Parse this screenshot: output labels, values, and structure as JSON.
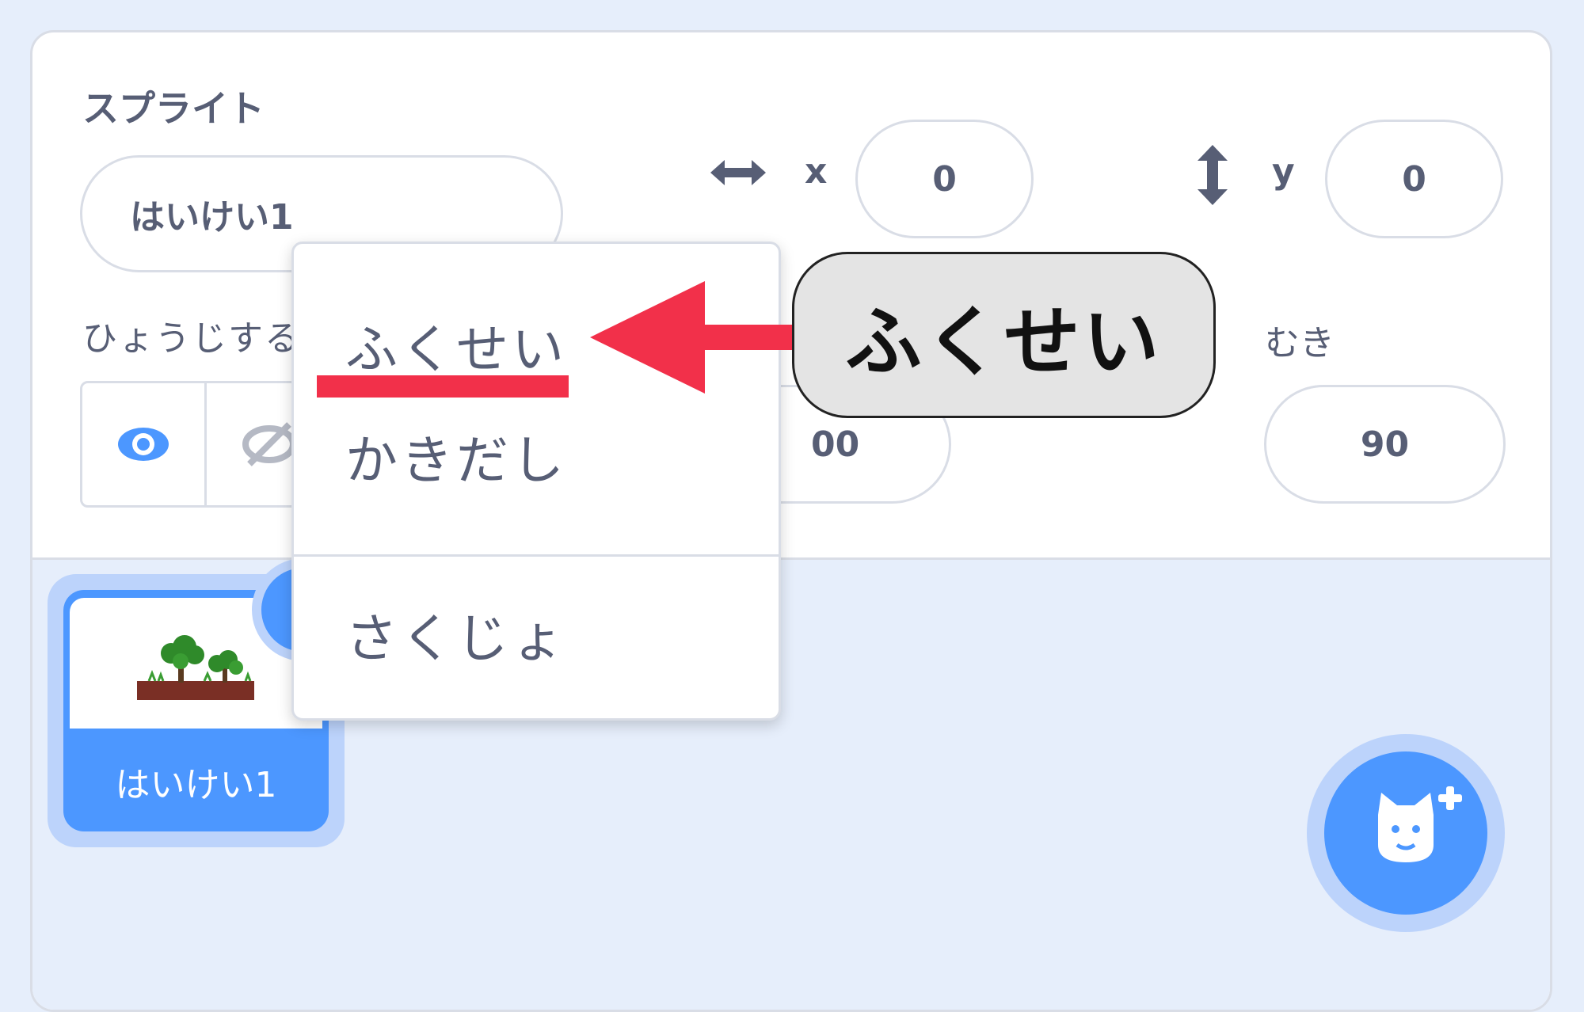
{
  "sprite_info": {
    "section_label": "スプライト",
    "sprite_name": "はいけい1",
    "x_label": "x",
    "x_value": "0",
    "y_label": "y",
    "y_value": "0",
    "show_label": "ひょうじする",
    "size_value": "00",
    "direction_label": "むき",
    "direction_value": "90"
  },
  "sprite_list": {
    "tiles": [
      {
        "name": "はいけい1",
        "selected": true
      }
    ]
  },
  "context_menu": {
    "items": [
      {
        "label": "ふくせい"
      },
      {
        "label": "かきだし"
      },
      {
        "label": "さくじょ"
      }
    ]
  },
  "annotation": {
    "callout_text": "ふくせい",
    "arrow_color": "#f2304a"
  },
  "colors": {
    "accent": "#4c97ff",
    "text": "#575e75",
    "background": "#e6eefb"
  }
}
